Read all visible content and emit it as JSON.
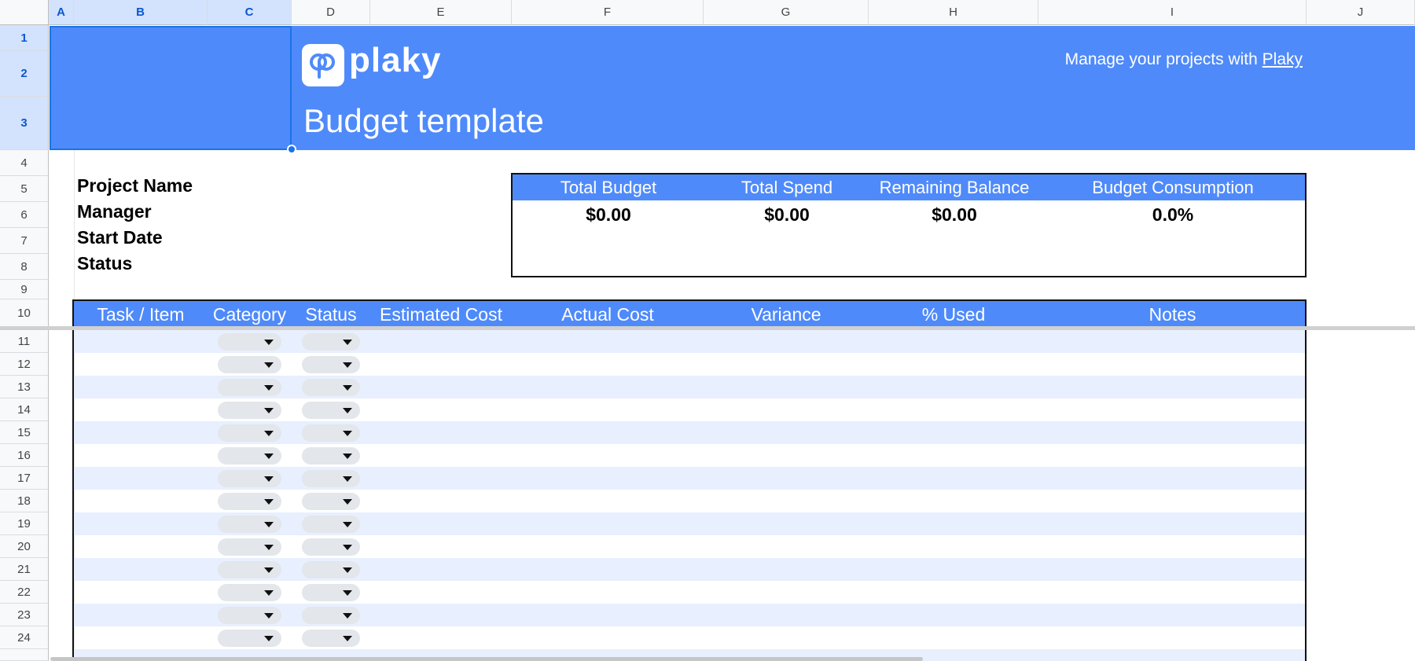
{
  "columns": [
    "A",
    "B",
    "C",
    "D",
    "E",
    "F",
    "G",
    "H",
    "I",
    "J"
  ],
  "rows": [
    "1",
    "2",
    "3",
    "4",
    "5",
    "6",
    "7",
    "8",
    "9",
    "10",
    "11",
    "12",
    "13",
    "14",
    "15",
    "16",
    "17",
    "18",
    "19",
    "20",
    "21",
    "22",
    "23",
    "24"
  ],
  "banner": {
    "logo_text": "plaky",
    "title": "Budget template",
    "tagline_prefix": "Manage your projects with",
    "tagline_link": "Plaky",
    "color": "#4f8afa"
  },
  "project_info": {
    "labels": [
      "Project Name",
      "Manager",
      "Start Date",
      "Status"
    ]
  },
  "summary": {
    "items": [
      {
        "label": "Total Budget",
        "value": "$0.00"
      },
      {
        "label": "Total Spend",
        "value": "$0.00"
      },
      {
        "label": "Remaining Balance",
        "value": "$0.00"
      },
      {
        "label": "Budget Consumption",
        "value": "0.0%"
      }
    ]
  },
  "table": {
    "headers": [
      "Task / Item",
      "Category",
      "Status",
      "Estimated Cost",
      "Actual Cost",
      "Variance",
      "% Used",
      "Notes"
    ],
    "band_color": "#e8effe"
  },
  "icons": {
    "dropdown": "chevron-down-icon"
  }
}
